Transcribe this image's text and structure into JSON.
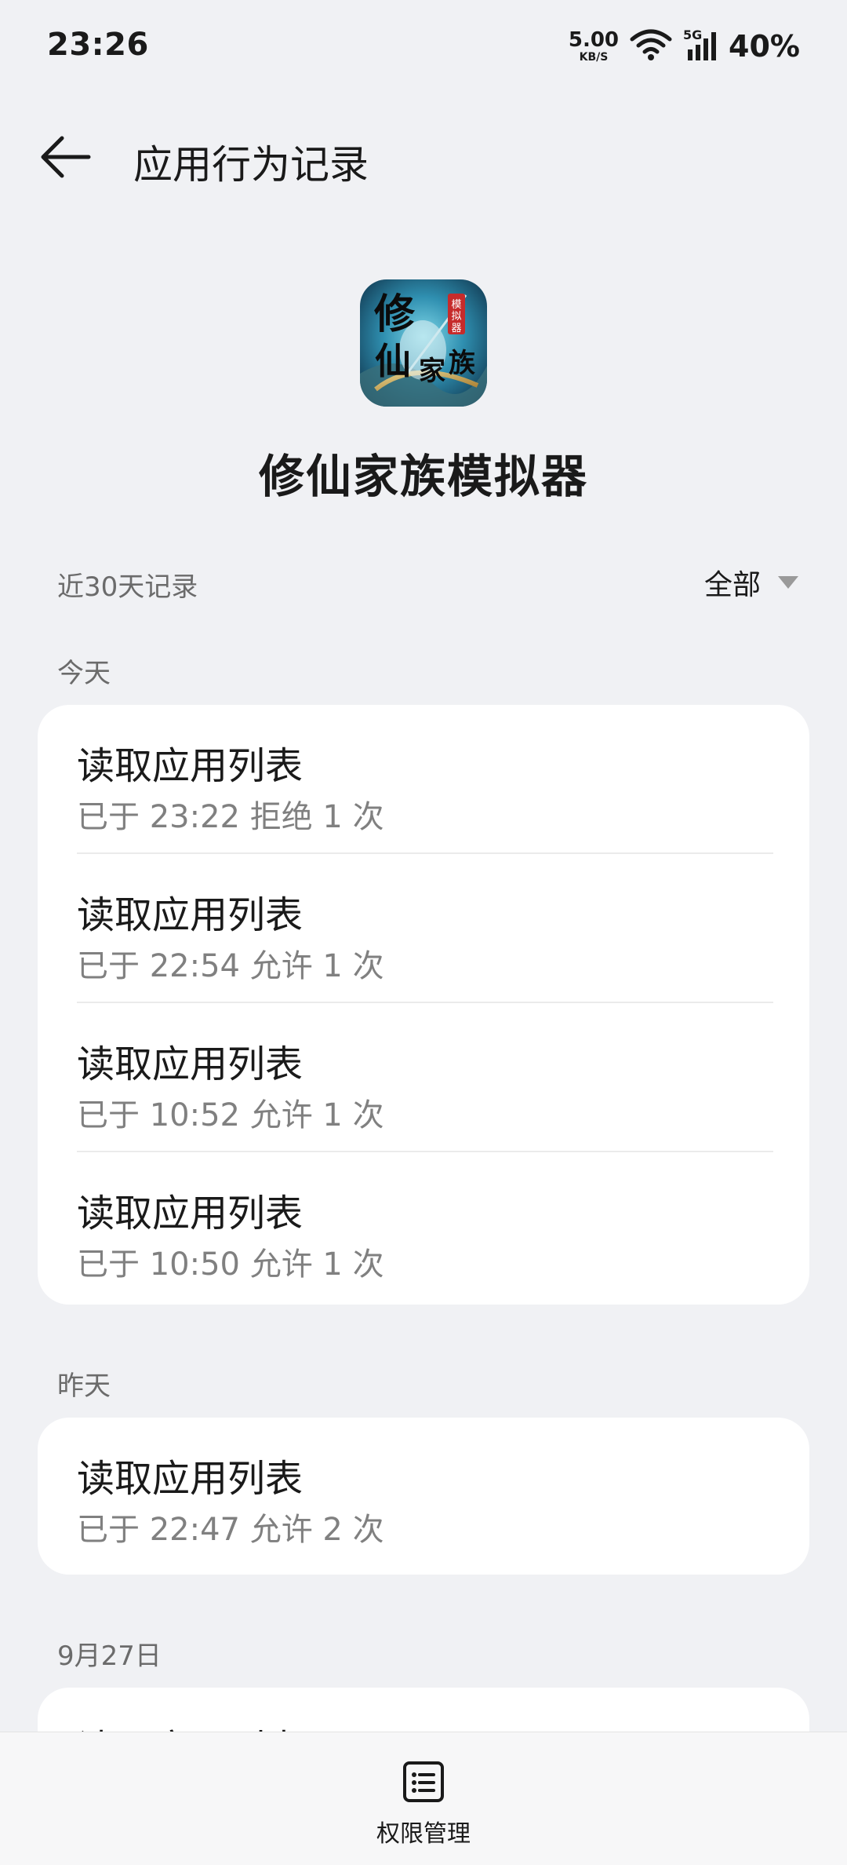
{
  "status_bar": {
    "time": "23:26",
    "net_speed_value": "5.00",
    "net_speed_unit": "KB/S",
    "network_type": "5G",
    "battery": "40%"
  },
  "header": {
    "title": "应用行为记录"
  },
  "app": {
    "name": "修仙家族模拟器",
    "icon_text_main": "修仙家族",
    "icon_text_badge": "模拟器"
  },
  "filter": {
    "range_label": "近30天记录",
    "selected": "全部"
  },
  "sections": [
    {
      "label": "今天",
      "records": [
        {
          "title": "读取应用列表",
          "detail": "已于 23:22 拒绝 1 次"
        },
        {
          "title": "读取应用列表",
          "detail": "已于 22:54 允许 1 次"
        },
        {
          "title": "读取应用列表",
          "detail": "已于 10:52 允许 1 次"
        },
        {
          "title": "读取应用列表",
          "detail": "已于 10:50 允许 1 次"
        }
      ]
    },
    {
      "label": "昨天",
      "records": [
        {
          "title": "读取应用列表",
          "detail": "已于 22:47 允许 2 次"
        }
      ]
    },
    {
      "label": "9月27日",
      "records": [
        {
          "title": "读取应用列表"
        }
      ]
    }
  ],
  "bottom_bar": {
    "permission_label": "权限管理",
    "permission_icon": "list-icon"
  },
  "colors": {
    "background": "#f0f1f4",
    "card": "#ffffff",
    "secondary_text": "#808080"
  }
}
